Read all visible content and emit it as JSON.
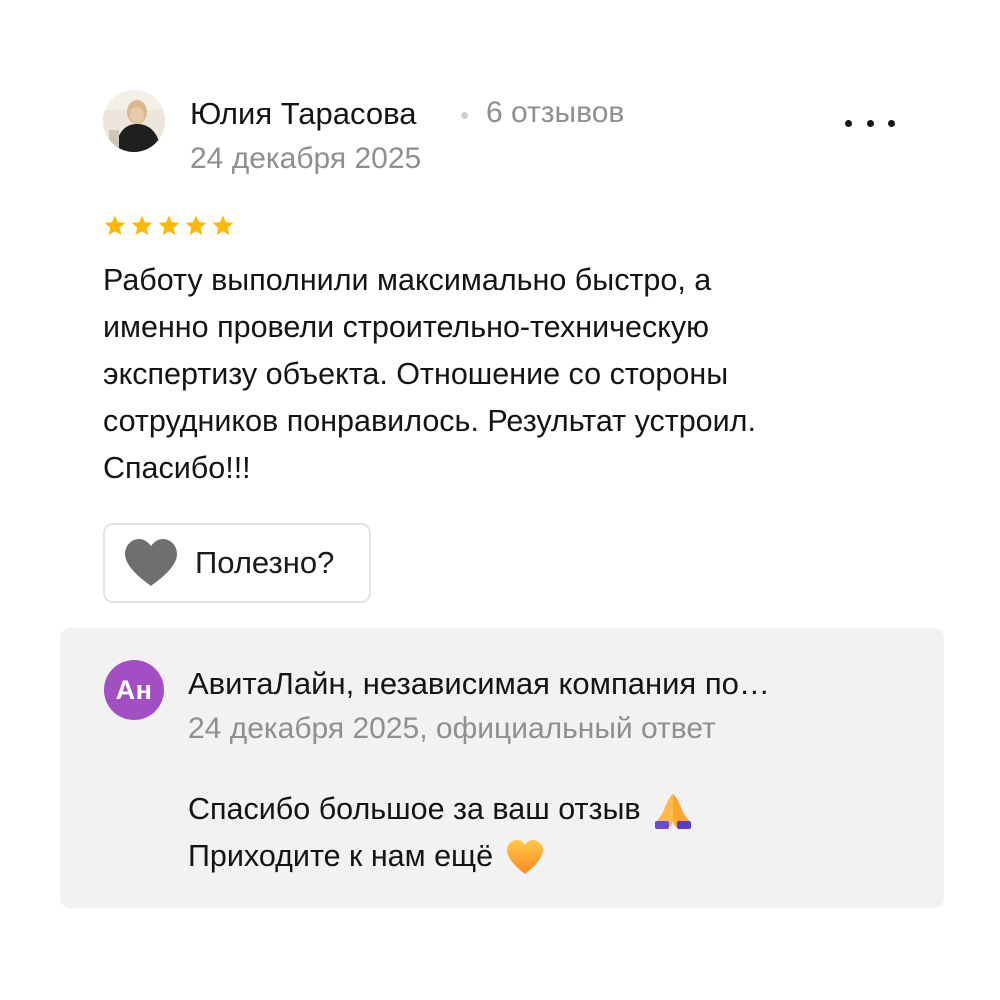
{
  "review": {
    "author_name": "Юлия Тарасова",
    "review_count": "6 отзывов",
    "date": "24 декабря 2025",
    "rating": 5,
    "text": "Работу выполнили максимально быстро, а\nименно провели строительно-техническую\nэкспертизу объекта. Отношение со стороны\nсотрудников понравилось. Результат устроил.\nСпасибо!!!",
    "helpful_label": "Полезно?"
  },
  "reply": {
    "avatar_initials": "Ан",
    "company_name": "АвитаЛайн, независимая компания по…",
    "meta": "24 декабря 2025, официальный ответ",
    "line1": "Спасибо большое за ваш отзыв",
    "line2": "Приходите к нам ещё"
  },
  "icons": {
    "more": "more-horizontal-icon",
    "star": "star-icon",
    "helpful": "heart-icon",
    "emoji1": "folded-hands-emoji",
    "emoji2": "orange-heart-emoji"
  },
  "colors": {
    "star": "#ffb800",
    "muted_text": "#8f8f8f",
    "reply_bg": "#f2f2f2",
    "reply_avatar": "#a24fc4",
    "heart_gray": "#6f6f6f"
  }
}
